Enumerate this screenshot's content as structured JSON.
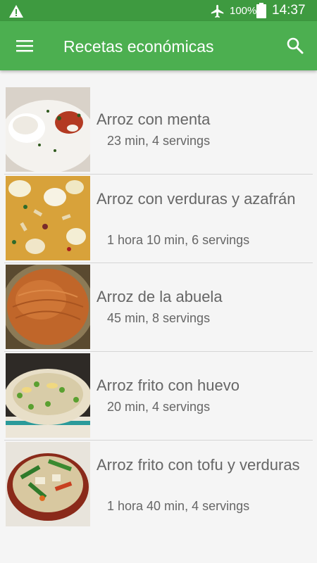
{
  "status_bar": {
    "battery_percent": "100%",
    "time": "14:37",
    "icons": [
      "warning-icon",
      "airplane-mode-icon",
      "battery-icon"
    ]
  },
  "app_bar": {
    "title": "Recetas económicas",
    "icons": [
      "menu-icon",
      "search-icon"
    ]
  },
  "recipes": [
    {
      "name": "Arroz con menta",
      "meta": "23 min, 4 servings"
    },
    {
      "name": "Arroz con verduras y azafrán",
      "meta": "1 hora 10 min, 6 servings"
    },
    {
      "name": "Arroz de la abuela",
      "meta": "45 min, 8 servings"
    },
    {
      "name": "Arroz frito con huevo",
      "meta": "20 min, 4 servings"
    },
    {
      "name": "Arroz frito con tofu y verduras",
      "meta": "1 hora 40 min, 4 servings"
    }
  ],
  "colors": {
    "status_bar": "#3e9a40",
    "app_bar": "#4caf50",
    "background": "#f5f5f5",
    "text": "#666666"
  }
}
